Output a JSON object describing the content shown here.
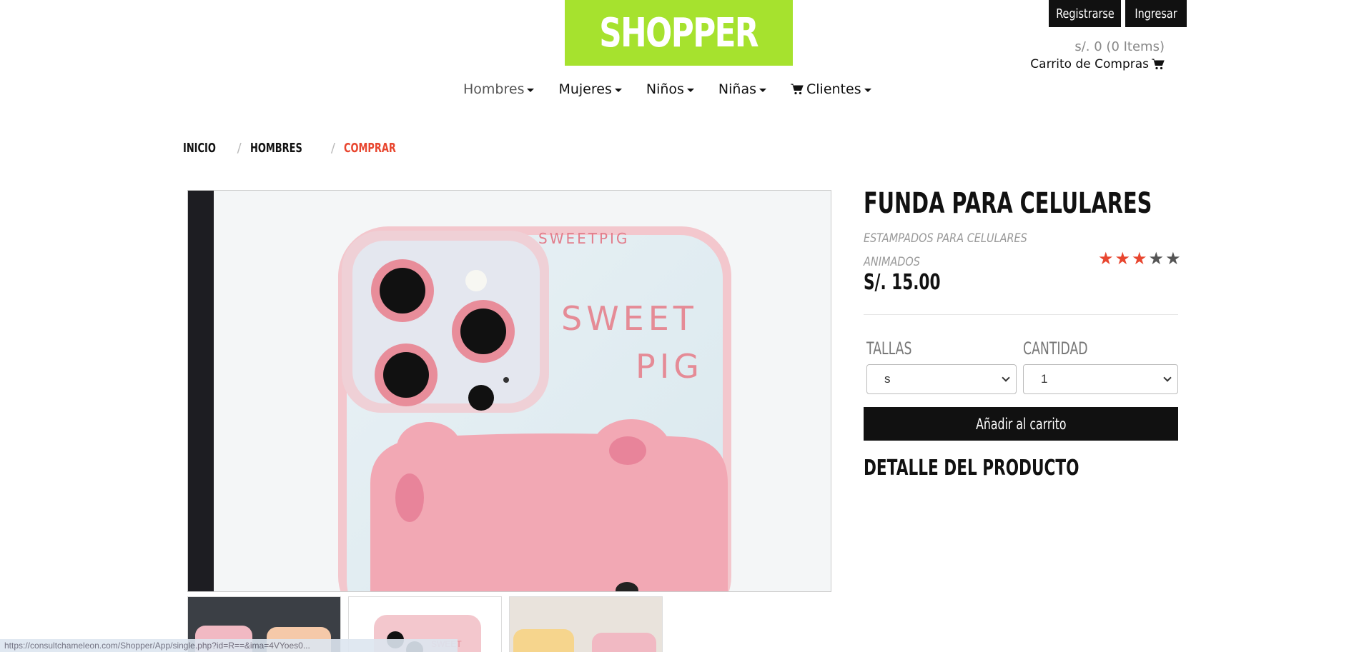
{
  "brand": {
    "logo_text": "SHOPPER",
    "accent": "#a6e22e"
  },
  "auth": {
    "register_label": "Registrarse",
    "login_label": "Ingresar"
  },
  "cart": {
    "amount": "s/. 0 (0 Items)",
    "label": "Carrito de Compras",
    "icon": "shopping-cart-icon"
  },
  "nav": {
    "items": [
      {
        "label": "Hombres",
        "active": true
      },
      {
        "label": "Mujeres"
      },
      {
        "label": "Niños"
      },
      {
        "label": "Niñas"
      },
      {
        "label": "Clientes",
        "icon": "shopping-cart-icon"
      }
    ]
  },
  "breadcrumb": {
    "items": [
      "INICIO",
      "HOMBRES",
      "COMPRAR"
    ],
    "separator": "/",
    "current_color": "#e8462f"
  },
  "product": {
    "title": "FUNDA PARA CELULARES",
    "subtitle_line1": "ESTAMPADOS PARA CELULARES",
    "subtitle_line2": "ANIMADOS",
    "price": "S/. 15.00",
    "rating": {
      "value": 3,
      "max": 5
    },
    "image": {
      "case_text_top": "SWEETPIG",
      "case_text_main1": "SWEET",
      "case_text_main2": "PIG"
    }
  },
  "options": {
    "size_label": "TALLAS",
    "size_value": "s",
    "qty_label": "CANTIDAD",
    "qty_value": "1"
  },
  "actions": {
    "add_to_cart_label": "Añadir al carrito"
  },
  "detail": {
    "title": "DETALLE DEL PRODUCTO"
  },
  "status_bar": {
    "url": "https://consultchameleon.com/Shopper/App/single.php?id=R==&ima=4VYoes0... "
  }
}
